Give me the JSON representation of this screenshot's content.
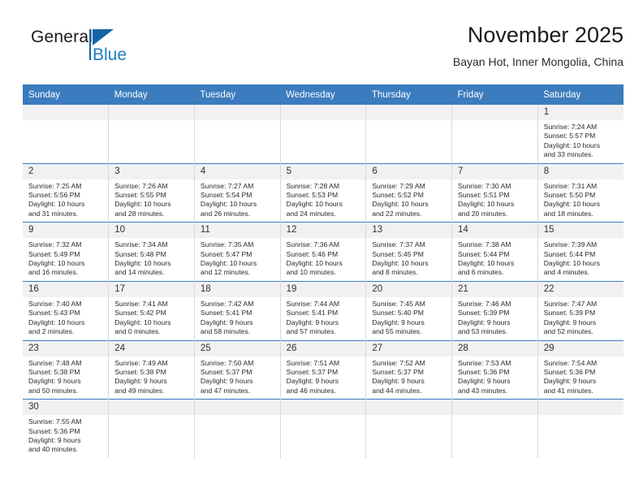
{
  "logo": {
    "name_top": "General",
    "name_bottom": "Blue",
    "accent_color": "#1464a5",
    "blue_text_color": "#1b7cc4"
  },
  "header": {
    "title": "November 2025",
    "subtitle": "Bayan Hot, Inner Mongolia, China"
  },
  "theme": {
    "header_blue": "#3b7cbe",
    "daynum_band": "#f1f1f1",
    "cell_border": "#d8d8d8"
  },
  "weekdays": [
    "Sunday",
    "Monday",
    "Tuesday",
    "Wednesday",
    "Thursday",
    "Friday",
    "Saturday"
  ],
  "labels": {
    "sunrise_prefix": "Sunrise: ",
    "sunset_prefix": "Sunset: ",
    "daylight_prefix": "Daylight: "
  },
  "weeks": [
    [
      {
        "day": "",
        "blank": true
      },
      {
        "day": "",
        "blank": true
      },
      {
        "day": "",
        "blank": true
      },
      {
        "day": "",
        "blank": true
      },
      {
        "day": "",
        "blank": true
      },
      {
        "day": "",
        "blank": true
      },
      {
        "day": "1",
        "sunrise": "Sunrise: 7:24 AM",
        "sunset": "Sunset: 5:57 PM",
        "daylight1": "Daylight: 10 hours",
        "daylight2": "and 33 minutes."
      }
    ],
    [
      {
        "day": "2",
        "sunrise": "Sunrise: 7:25 AM",
        "sunset": "Sunset: 5:56 PM",
        "daylight1": "Daylight: 10 hours",
        "daylight2": "and 31 minutes."
      },
      {
        "day": "3",
        "sunrise": "Sunrise: 7:26 AM",
        "sunset": "Sunset: 5:55 PM",
        "daylight1": "Daylight: 10 hours",
        "daylight2": "and 28 minutes."
      },
      {
        "day": "4",
        "sunrise": "Sunrise: 7:27 AM",
        "sunset": "Sunset: 5:54 PM",
        "daylight1": "Daylight: 10 hours",
        "daylight2": "and 26 minutes."
      },
      {
        "day": "5",
        "sunrise": "Sunrise: 7:28 AM",
        "sunset": "Sunset: 5:53 PM",
        "daylight1": "Daylight: 10 hours",
        "daylight2": "and 24 minutes."
      },
      {
        "day": "6",
        "sunrise": "Sunrise: 7:29 AM",
        "sunset": "Sunset: 5:52 PM",
        "daylight1": "Daylight: 10 hours",
        "daylight2": "and 22 minutes."
      },
      {
        "day": "7",
        "sunrise": "Sunrise: 7:30 AM",
        "sunset": "Sunset: 5:51 PM",
        "daylight1": "Daylight: 10 hours",
        "daylight2": "and 20 minutes."
      },
      {
        "day": "8",
        "sunrise": "Sunrise: 7:31 AM",
        "sunset": "Sunset: 5:50 PM",
        "daylight1": "Daylight: 10 hours",
        "daylight2": "and 18 minutes."
      }
    ],
    [
      {
        "day": "9",
        "sunrise": "Sunrise: 7:32 AM",
        "sunset": "Sunset: 5:49 PM",
        "daylight1": "Daylight: 10 hours",
        "daylight2": "and 16 minutes."
      },
      {
        "day": "10",
        "sunrise": "Sunrise: 7:34 AM",
        "sunset": "Sunset: 5:48 PM",
        "daylight1": "Daylight: 10 hours",
        "daylight2": "and 14 minutes."
      },
      {
        "day": "11",
        "sunrise": "Sunrise: 7:35 AM",
        "sunset": "Sunset: 5:47 PM",
        "daylight1": "Daylight: 10 hours",
        "daylight2": "and 12 minutes."
      },
      {
        "day": "12",
        "sunrise": "Sunrise: 7:36 AM",
        "sunset": "Sunset: 5:46 PM",
        "daylight1": "Daylight: 10 hours",
        "daylight2": "and 10 minutes."
      },
      {
        "day": "13",
        "sunrise": "Sunrise: 7:37 AM",
        "sunset": "Sunset: 5:45 PM",
        "daylight1": "Daylight: 10 hours",
        "daylight2": "and 8 minutes."
      },
      {
        "day": "14",
        "sunrise": "Sunrise: 7:38 AM",
        "sunset": "Sunset: 5:44 PM",
        "daylight1": "Daylight: 10 hours",
        "daylight2": "and 6 minutes."
      },
      {
        "day": "15",
        "sunrise": "Sunrise: 7:39 AM",
        "sunset": "Sunset: 5:44 PM",
        "daylight1": "Daylight: 10 hours",
        "daylight2": "and 4 minutes."
      }
    ],
    [
      {
        "day": "16",
        "sunrise": "Sunrise: 7:40 AM",
        "sunset": "Sunset: 5:43 PM",
        "daylight1": "Daylight: 10 hours",
        "daylight2": "and 2 minutes."
      },
      {
        "day": "17",
        "sunrise": "Sunrise: 7:41 AM",
        "sunset": "Sunset: 5:42 PM",
        "daylight1": "Daylight: 10 hours",
        "daylight2": "and 0 minutes."
      },
      {
        "day": "18",
        "sunrise": "Sunrise: 7:42 AM",
        "sunset": "Sunset: 5:41 PM",
        "daylight1": "Daylight: 9 hours",
        "daylight2": "and 58 minutes."
      },
      {
        "day": "19",
        "sunrise": "Sunrise: 7:44 AM",
        "sunset": "Sunset: 5:41 PM",
        "daylight1": "Daylight: 9 hours",
        "daylight2": "and 57 minutes."
      },
      {
        "day": "20",
        "sunrise": "Sunrise: 7:45 AM",
        "sunset": "Sunset: 5:40 PM",
        "daylight1": "Daylight: 9 hours",
        "daylight2": "and 55 minutes."
      },
      {
        "day": "21",
        "sunrise": "Sunrise: 7:46 AM",
        "sunset": "Sunset: 5:39 PM",
        "daylight1": "Daylight: 9 hours",
        "daylight2": "and 53 minutes."
      },
      {
        "day": "22",
        "sunrise": "Sunrise: 7:47 AM",
        "sunset": "Sunset: 5:39 PM",
        "daylight1": "Daylight: 9 hours",
        "daylight2": "and 52 minutes."
      }
    ],
    [
      {
        "day": "23",
        "sunrise": "Sunrise: 7:48 AM",
        "sunset": "Sunset: 5:38 PM",
        "daylight1": "Daylight: 9 hours",
        "daylight2": "and 50 minutes."
      },
      {
        "day": "24",
        "sunrise": "Sunrise: 7:49 AM",
        "sunset": "Sunset: 5:38 PM",
        "daylight1": "Daylight: 9 hours",
        "daylight2": "and 49 minutes."
      },
      {
        "day": "25",
        "sunrise": "Sunrise: 7:50 AM",
        "sunset": "Sunset: 5:37 PM",
        "daylight1": "Daylight: 9 hours",
        "daylight2": "and 47 minutes."
      },
      {
        "day": "26",
        "sunrise": "Sunrise: 7:51 AM",
        "sunset": "Sunset: 5:37 PM",
        "daylight1": "Daylight: 9 hours",
        "daylight2": "and 46 minutes."
      },
      {
        "day": "27",
        "sunrise": "Sunrise: 7:52 AM",
        "sunset": "Sunset: 5:37 PM",
        "daylight1": "Daylight: 9 hours",
        "daylight2": "and 44 minutes."
      },
      {
        "day": "28",
        "sunrise": "Sunrise: 7:53 AM",
        "sunset": "Sunset: 5:36 PM",
        "daylight1": "Daylight: 9 hours",
        "daylight2": "and 43 minutes."
      },
      {
        "day": "29",
        "sunrise": "Sunrise: 7:54 AM",
        "sunset": "Sunset: 5:36 PM",
        "daylight1": "Daylight: 9 hours",
        "daylight2": "and 41 minutes."
      }
    ],
    [
      {
        "day": "30",
        "sunrise": "Sunrise: 7:55 AM",
        "sunset": "Sunset: 5:36 PM",
        "daylight1": "Daylight: 9 hours",
        "daylight2": "and 40 minutes."
      },
      {
        "day": "",
        "blank": true
      },
      {
        "day": "",
        "blank": true
      },
      {
        "day": "",
        "blank": true
      },
      {
        "day": "",
        "blank": true
      },
      {
        "day": "",
        "blank": true
      },
      {
        "day": "",
        "blank": true
      }
    ]
  ]
}
